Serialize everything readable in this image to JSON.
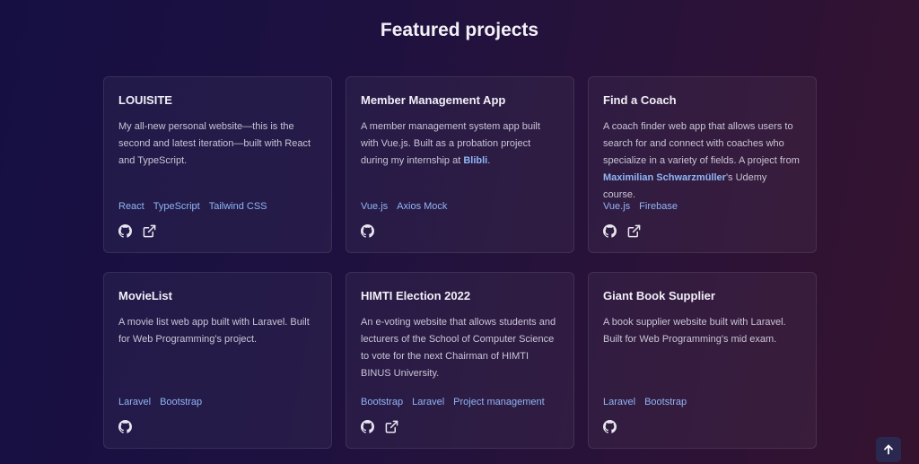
{
  "page": {
    "heading": "Featured projects"
  },
  "colors": {
    "accent_link": "#8fb6f5",
    "background_left": "#161042",
    "background_right": "#35132f"
  },
  "projects": [
    {
      "title": "LOUISITE",
      "desc_before": "My all-new personal website—this is the second and latest iteration—built with React and TypeScript.",
      "desc_link": "",
      "desc_after": "",
      "tags": [
        "React",
        "TypeScript",
        "Tailwind CSS"
      ],
      "icons": [
        "github-icon",
        "external-link-icon"
      ]
    },
    {
      "title": "Member Management App",
      "desc_before": "A member management system app built with Vue.js. Built as a probation project during my internship at ",
      "desc_link": "Blibli",
      "desc_after": ".",
      "tags": [
        "Vue.js",
        "Axios Mock"
      ],
      "icons": [
        "github-icon"
      ]
    },
    {
      "title": "Find a Coach",
      "desc_before": "A coach finder web app that allows users to search for and connect with coaches who specialize in a variety of fields. A project from ",
      "desc_link": "Maximilian Schwarzmüller",
      "desc_after": "'s Udemy course.",
      "tags": [
        "Vue.js",
        "Firebase"
      ],
      "icons": [
        "github-icon",
        "external-link-icon"
      ]
    },
    {
      "title": "MovieList",
      "desc_before": "A movie list web app built with Laravel. Built for Web Programming's project.",
      "desc_link": "",
      "desc_after": "",
      "tags": [
        "Laravel",
        "Bootstrap"
      ],
      "icons": [
        "github-icon"
      ]
    },
    {
      "title": "HIMTI Election 2022",
      "desc_before": "An e-voting website that allows students and lecturers of the School of Computer Science to vote for the next Chairman of HIMTI BINUS University.",
      "desc_link": "",
      "desc_after": "",
      "tags": [
        "Bootstrap",
        "Laravel",
        "Project management"
      ],
      "icons": [
        "github-icon",
        "external-link-icon"
      ]
    },
    {
      "title": "Giant Book Supplier",
      "desc_before": "A book supplier website built with Laravel. Built for Web Programming's mid exam.",
      "desc_link": "",
      "desc_after": "",
      "tags": [
        "Laravel",
        "Bootstrap"
      ],
      "icons": [
        "github-icon"
      ]
    }
  ],
  "scroll_top": {
    "icon": "arrow-up-icon"
  }
}
